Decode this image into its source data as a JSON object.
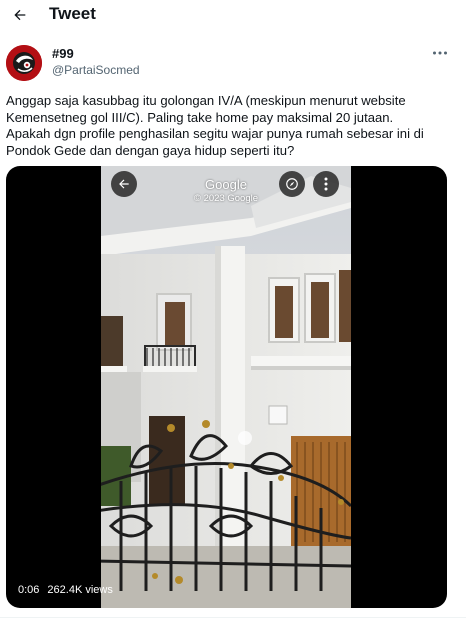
{
  "header": {
    "title": "Tweet"
  },
  "tweet": {
    "author_name": "#99",
    "author_handle": "@PartaiSocmed",
    "text_lines": [
      "Anggap saja kasubbag itu golongan IV/A (meskipun menurut website",
      "Kemensetneg gol III/C). Paling take home pay maksimal 20 jutaan.",
      "Apakah dgn profile penghasilan segitu wajar punya rumah sebesar ini di",
      "Pondok Gede dan dengan gaya hidup seperti itu?"
    ]
  },
  "video": {
    "overlay_title": "Google",
    "overlay_copyright": "© 2023 Google",
    "time": "0:06",
    "views": "262.4K views"
  },
  "colors": {
    "text": "#0f1419",
    "secondary_text": "#536471",
    "avatar_bg": "#b30f14",
    "video_bg": "#000000"
  },
  "icons": {
    "back": "arrow-left-icon",
    "more": "more-horizontal-icon",
    "sv_back": "arrow-left-icon",
    "compass": "compass-icon",
    "sv_more": "more-vertical-icon"
  }
}
